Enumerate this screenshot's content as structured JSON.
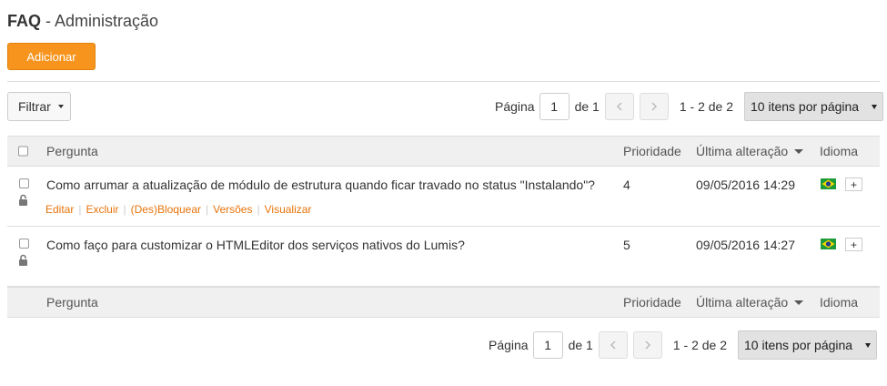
{
  "header": {
    "title_bold": "FAQ",
    "title_rest": " - Administração"
  },
  "toolbar": {
    "add_label": "Adicionar",
    "filter_label": "Filtrar"
  },
  "pager": {
    "page_label": "Página",
    "page_value": "1",
    "of_label": "de 1",
    "range": "1 - 2 de 2",
    "per_page": "10 itens por página"
  },
  "table": {
    "columns": {
      "question": "Pergunta",
      "priority": "Prioridade",
      "last_change": "Última alteração",
      "language": "Idioma"
    },
    "rows": [
      {
        "question": "Como arrumar a atualização de módulo de estrutura quando ficar travado no status \"Instalando\"?",
        "priority": "4",
        "date": "09/05/2016 14:29",
        "add": "+",
        "actions": [
          "Editar",
          "Excluir",
          "(Des)Bloquear",
          "Versões",
          "Visualizar"
        ]
      },
      {
        "question": "Como faço para customizar o HTMLEditor dos serviços nativos do Lumis?",
        "priority": "5",
        "date": "09/05/2016 14:27",
        "add": "+"
      }
    ]
  },
  "colors": {
    "accent": "#f7941d",
    "link": "#e8730a",
    "header_bg": "#f0f0f0"
  },
  "icons": [
    "caret-down-icon",
    "prev-page-icon",
    "next-page-icon",
    "lock-icon",
    "brazil-flag-icon",
    "sort-desc-icon"
  ]
}
